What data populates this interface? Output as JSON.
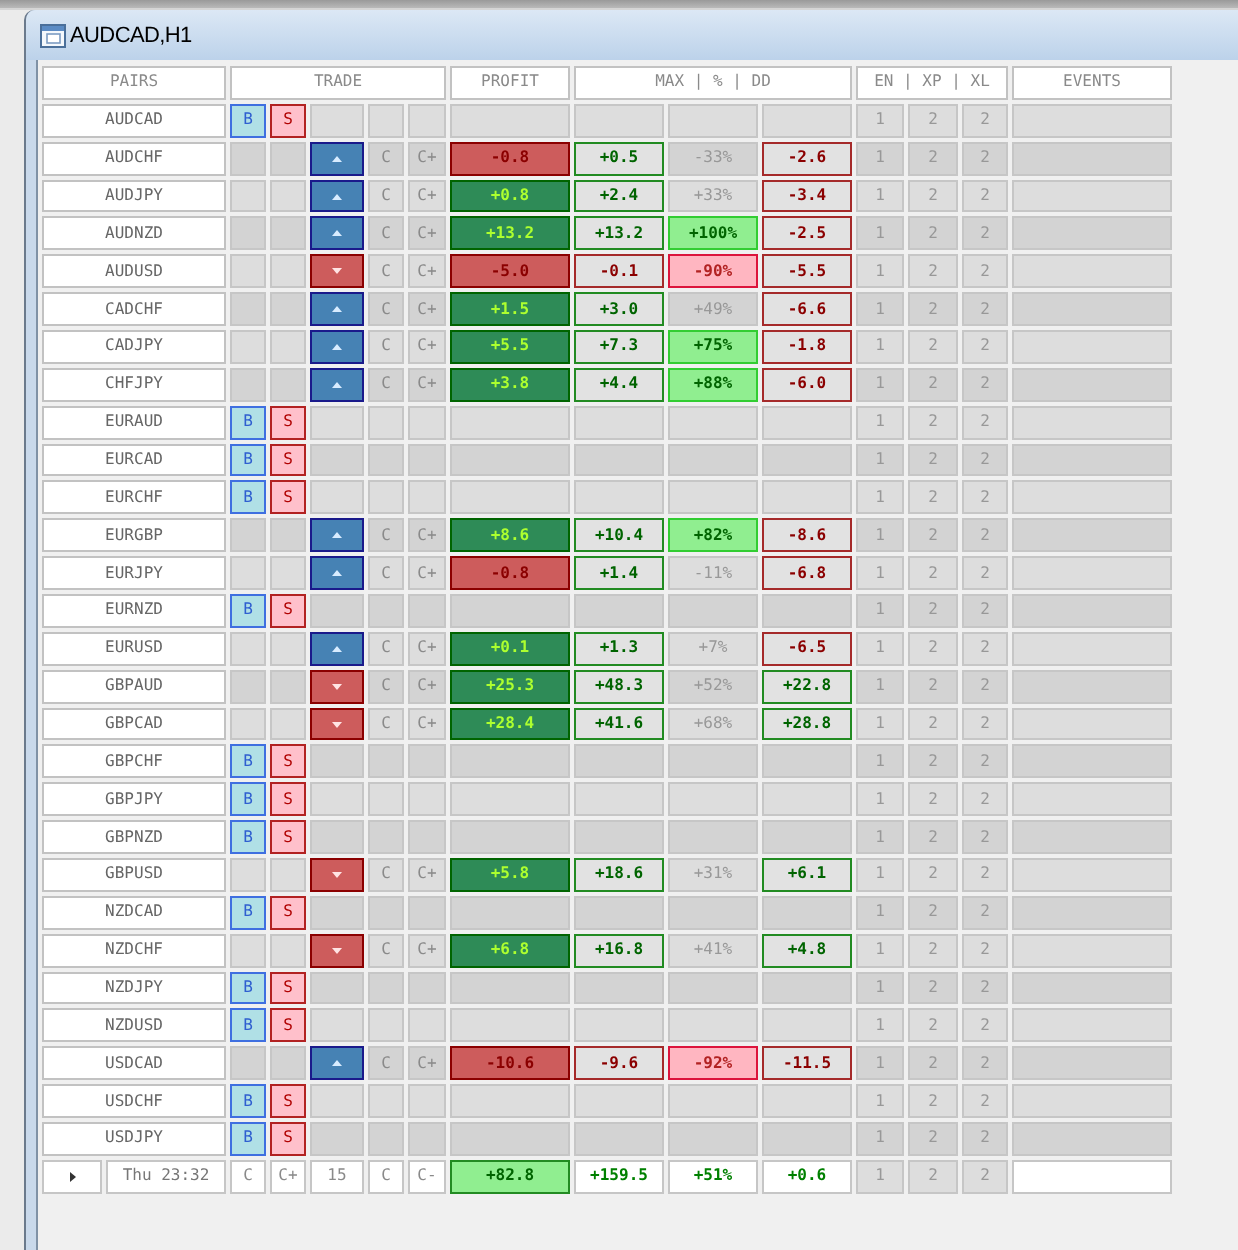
{
  "window": {
    "title": "AUDCAD,H1"
  },
  "table": {
    "columns": [
      "PAIRS",
      "TRADE",
      "PROFIT",
      "MAX | % | DD",
      "EN | XP | XL",
      "EVENTS"
    ],
    "rows": [
      {
        "pair": "AUDCAD",
        "kind": "idle",
        "buy": "B",
        "sell": "S",
        "en": "1",
        "xp": "2",
        "xl": "2"
      },
      {
        "pair": "AUDCHF",
        "kind": "open",
        "arrow_up": true,
        "c_button": "C",
        "c_plus_button": "C+",
        "profit": {
          "text": "-0.8",
          "gain": false
        },
        "max": {
          "text": "+0.5",
          "gain": true
        },
        "percent": {
          "text": "-33%",
          "highlighted": false
        },
        "drawdown": {
          "text": "-2.6",
          "gain": false
        },
        "en": "1",
        "xp": "2",
        "xl": "2"
      },
      {
        "pair": "AUDJPY",
        "kind": "open",
        "arrow_up": true,
        "c_button": "C",
        "c_plus_button": "C+",
        "profit": {
          "text": "+0.8",
          "gain": true
        },
        "max": {
          "text": "+2.4",
          "gain": true
        },
        "percent": {
          "text": "+33%",
          "highlighted": false
        },
        "drawdown": {
          "text": "-3.4",
          "gain": false
        },
        "en": "1",
        "xp": "2",
        "xl": "2"
      },
      {
        "pair": "AUDNZD",
        "kind": "open",
        "arrow_up": true,
        "c_button": "C",
        "c_plus_button": "C+",
        "profit": {
          "text": "+13.2",
          "gain": true
        },
        "max": {
          "text": "+13.2",
          "gain": true
        },
        "percent": {
          "text": "+100%",
          "highlighted": true,
          "gain": true
        },
        "drawdown": {
          "text": "-2.5",
          "gain": false
        },
        "en": "1",
        "xp": "2",
        "xl": "2"
      },
      {
        "pair": "AUDUSD",
        "kind": "open",
        "arrow_up": false,
        "c_button": "C",
        "c_plus_button": "C+",
        "profit": {
          "text": "-5.0",
          "gain": false
        },
        "max": {
          "text": "-0.1",
          "gain": false
        },
        "percent": {
          "text": "-90%",
          "highlighted": true,
          "gain": false
        },
        "drawdown": {
          "text": "-5.5",
          "gain": false
        },
        "en": "1",
        "xp": "2",
        "xl": "2"
      },
      {
        "pair": "CADCHF",
        "kind": "open",
        "arrow_up": true,
        "c_button": "C",
        "c_plus_button": "C+",
        "profit": {
          "text": "+1.5",
          "gain": true
        },
        "max": {
          "text": "+3.0",
          "gain": true
        },
        "percent": {
          "text": "+49%",
          "highlighted": false
        },
        "drawdown": {
          "text": "-6.6",
          "gain": false
        },
        "en": "1",
        "xp": "2",
        "xl": "2"
      },
      {
        "pair": "CADJPY",
        "kind": "open",
        "arrow_up": true,
        "c_button": "C",
        "c_plus_button": "C+",
        "profit": {
          "text": "+5.5",
          "gain": true
        },
        "max": {
          "text": "+7.3",
          "gain": true
        },
        "percent": {
          "text": "+75%",
          "highlighted": true,
          "gain": true
        },
        "drawdown": {
          "text": "-1.8",
          "gain": false
        },
        "en": "1",
        "xp": "2",
        "xl": "2"
      },
      {
        "pair": "CHFJPY",
        "kind": "open",
        "arrow_up": true,
        "c_button": "C",
        "c_plus_button": "C+",
        "profit": {
          "text": "+3.8",
          "gain": true
        },
        "max": {
          "text": "+4.4",
          "gain": true
        },
        "percent": {
          "text": "+88%",
          "highlighted": true,
          "gain": true
        },
        "drawdown": {
          "text": "-6.0",
          "gain": false
        },
        "en": "1",
        "xp": "2",
        "xl": "2"
      },
      {
        "pair": "EURAUD",
        "kind": "idle",
        "buy": "B",
        "sell": "S",
        "en": "1",
        "xp": "2",
        "xl": "2"
      },
      {
        "pair": "EURCAD",
        "kind": "idle",
        "buy": "B",
        "sell": "S",
        "en": "1",
        "xp": "2",
        "xl": "2"
      },
      {
        "pair": "EURCHF",
        "kind": "idle",
        "buy": "B",
        "sell": "S",
        "en": "1",
        "xp": "2",
        "xl": "2"
      },
      {
        "pair": "EURGBP",
        "kind": "open",
        "arrow_up": true,
        "c_button": "C",
        "c_plus_button": "C+",
        "profit": {
          "text": "+8.6",
          "gain": true
        },
        "max": {
          "text": "+10.4",
          "gain": true
        },
        "percent": {
          "text": "+82%",
          "highlighted": true,
          "gain": true
        },
        "drawdown": {
          "text": "-8.6",
          "gain": false
        },
        "en": "1",
        "xp": "2",
        "xl": "2"
      },
      {
        "pair": "EURJPY",
        "kind": "open",
        "arrow_up": true,
        "c_button": "C",
        "c_plus_button": "C+",
        "profit": {
          "text": "-0.8",
          "gain": false
        },
        "max": {
          "text": "+1.4",
          "gain": true
        },
        "percent": {
          "text": "-11%",
          "highlighted": false
        },
        "drawdown": {
          "text": "-6.8",
          "gain": false
        },
        "en": "1",
        "xp": "2",
        "xl": "2"
      },
      {
        "pair": "EURNZD",
        "kind": "idle",
        "buy": "B",
        "sell": "S",
        "en": "1",
        "xp": "2",
        "xl": "2"
      },
      {
        "pair": "EURUSD",
        "kind": "open",
        "arrow_up": true,
        "c_button": "C",
        "c_plus_button": "C+",
        "profit": {
          "text": "+0.1",
          "gain": true
        },
        "max": {
          "text": "+1.3",
          "gain": true
        },
        "percent": {
          "text": "+7%",
          "highlighted": false
        },
        "drawdown": {
          "text": "-6.5",
          "gain": false
        },
        "en": "1",
        "xp": "2",
        "xl": "2"
      },
      {
        "pair": "GBPAUD",
        "kind": "open",
        "arrow_up": false,
        "c_button": "C",
        "c_plus_button": "C+",
        "profit": {
          "text": "+25.3",
          "gain": true
        },
        "max": {
          "text": "+48.3",
          "gain": true
        },
        "percent": {
          "text": "+52%",
          "highlighted": false
        },
        "drawdown": {
          "text": "+22.8",
          "gain": true
        },
        "en": "1",
        "xp": "2",
        "xl": "2"
      },
      {
        "pair": "GBPCAD",
        "kind": "open",
        "arrow_up": false,
        "c_button": "C",
        "c_plus_button": "C+",
        "profit": {
          "text": "+28.4",
          "gain": true
        },
        "max": {
          "text": "+41.6",
          "gain": true
        },
        "percent": {
          "text": "+68%",
          "highlighted": false
        },
        "drawdown": {
          "text": "+28.8",
          "gain": true
        },
        "en": "1",
        "xp": "2",
        "xl": "2"
      },
      {
        "pair": "GBPCHF",
        "kind": "idle",
        "buy": "B",
        "sell": "S",
        "en": "1",
        "xp": "2",
        "xl": "2"
      },
      {
        "pair": "GBPJPY",
        "kind": "idle",
        "buy": "B",
        "sell": "S",
        "en": "1",
        "xp": "2",
        "xl": "2"
      },
      {
        "pair": "GBPNZD",
        "kind": "idle",
        "buy": "B",
        "sell": "S",
        "en": "1",
        "xp": "2",
        "xl": "2"
      },
      {
        "pair": "GBPUSD",
        "kind": "open",
        "arrow_up": false,
        "c_button": "C",
        "c_plus_button": "C+",
        "profit": {
          "text": "+5.8",
          "gain": true
        },
        "max": {
          "text": "+18.6",
          "gain": true
        },
        "percent": {
          "text": "+31%",
          "highlighted": false
        },
        "drawdown": {
          "text": "+6.1",
          "gain": true
        },
        "en": "1",
        "xp": "2",
        "xl": "2"
      },
      {
        "pair": "NZDCAD",
        "kind": "idle",
        "buy": "B",
        "sell": "S",
        "en": "1",
        "xp": "2",
        "xl": "2"
      },
      {
        "pair": "NZDCHF",
        "kind": "open",
        "arrow_up": false,
        "c_button": "C",
        "c_plus_button": "C+",
        "profit": {
          "text": "+6.8",
          "gain": true
        },
        "max": {
          "text": "+16.8",
          "gain": true
        },
        "percent": {
          "text": "+41%",
          "highlighted": false
        },
        "drawdown": {
          "text": "+4.8",
          "gain": true
        },
        "en": "1",
        "xp": "2",
        "xl": "2"
      },
      {
        "pair": "NZDJPY",
        "kind": "idle",
        "buy": "B",
        "sell": "S",
        "en": "1",
        "xp": "2",
        "xl": "2"
      },
      {
        "pair": "NZDUSD",
        "kind": "idle",
        "buy": "B",
        "sell": "S",
        "en": "1",
        "xp": "2",
        "xl": "2"
      },
      {
        "pair": "USDCAD",
        "kind": "open",
        "arrow_up": true,
        "c_button": "C",
        "c_plus_button": "C+",
        "profit": {
          "text": "-10.6",
          "gain": false
        },
        "max": {
          "text": "-9.6",
          "gain": false
        },
        "percent": {
          "text": "-92%",
          "highlighted": true,
          "gain": false
        },
        "drawdown": {
          "text": "-11.5",
          "gain": false
        },
        "en": "1",
        "xp": "2",
        "xl": "2"
      },
      {
        "pair": "USDCHF",
        "kind": "idle",
        "buy": "B",
        "sell": "S",
        "en": "1",
        "xp": "2",
        "xl": "2"
      },
      {
        "pair": "USDJPY",
        "kind": "idle",
        "buy": "B",
        "sell": "S",
        "en": "1",
        "xp": "2",
        "xl": "2"
      }
    ],
    "footer": {
      "time": "Thu 23:32",
      "c_button": "C",
      "c_plus_button": "C+",
      "number": "15",
      "c_button_2": "C",
      "c_minus_button": "C-",
      "profit": {
        "text": "+82.8",
        "gain": true
      },
      "max": {
        "text": "+159.5",
        "gain": true
      },
      "percent": {
        "text": "+51%",
        "gain": true
      },
      "drawdown": {
        "text": "+0.6",
        "gain": true
      },
      "en": "1",
      "xp": "2",
      "xl": "2"
    }
  }
}
